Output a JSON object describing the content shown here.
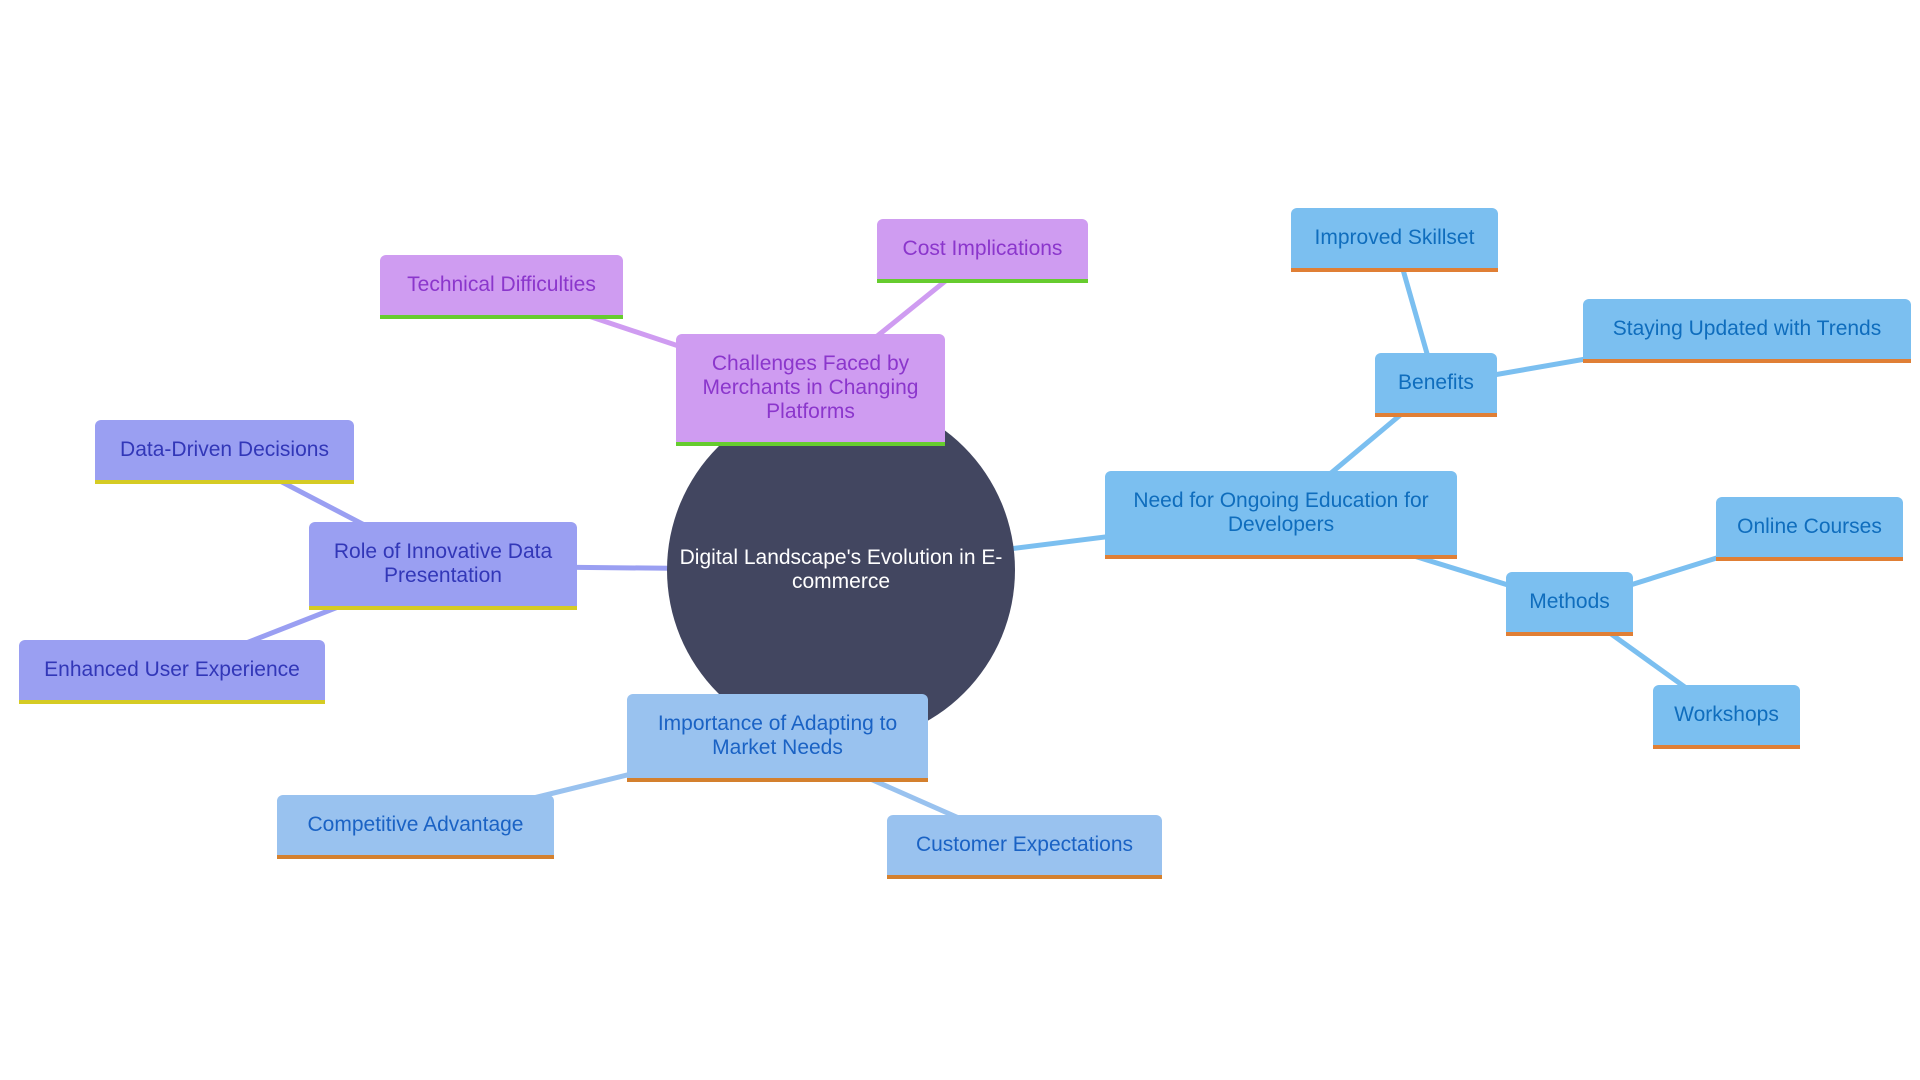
{
  "diagram": {
    "type": "mindmap",
    "root": {
      "id": "root",
      "label": "Digital Landscape's Evolution in E-commerce",
      "color": "#424660"
    },
    "branches": [
      {
        "id": "challenges",
        "label": "Challenges Faced by Merchants in Changing Platforms",
        "theme": "purple",
        "fill": "#cf9cf1",
        "text_color": "#8b36cc",
        "underline": "#66cc2e",
        "edge_color": "#cf9cf1",
        "children": [
          {
            "id": "tech",
            "label": "Technical Difficulties"
          },
          {
            "id": "cost",
            "label": "Cost Implications"
          }
        ]
      },
      {
        "id": "education",
        "label": "Need for Ongoing Education for Developers",
        "theme": "blue",
        "fill": "#7bbff0",
        "text_color": "#0f6dbd",
        "underline": "#e07f35",
        "edge_color": "#7bbff0",
        "children": [
          {
            "id": "benefits",
            "label": "Benefits",
            "children": [
              {
                "id": "skillset",
                "label": "Improved Skillset"
              },
              {
                "id": "trends",
                "label": "Staying Updated with Trends"
              }
            ]
          },
          {
            "id": "methods",
            "label": "Methods",
            "children": [
              {
                "id": "courses",
                "label": "Online Courses"
              },
              {
                "id": "workshops",
                "label": "Workshops"
              }
            ]
          }
        ]
      },
      {
        "id": "role",
        "label": "Role of Innovative Data Presentation",
        "theme": "indigo",
        "fill": "#9a9ff2",
        "text_color": "#3237b8",
        "underline": "#d5cb24",
        "edge_color": "#9a9ff2",
        "children": [
          {
            "id": "datadriven",
            "label": "Data-Driven Decisions"
          },
          {
            "id": "ux",
            "label": "Enhanced User Experience"
          }
        ]
      },
      {
        "id": "importance",
        "label": "Importance of Adapting to Market Needs",
        "theme": "lblue",
        "fill": "#99c2ef",
        "text_color": "#1a62c4",
        "underline": "#d4802e",
        "edge_color": "#99c2ef",
        "children": [
          {
            "id": "competitive",
            "label": "Competitive Advantage"
          },
          {
            "id": "customer",
            "label": "Customer Expectations"
          }
        ]
      }
    ],
    "edges": [
      {
        "from": "root",
        "to": "challenges",
        "color": "#cf9cf1"
      },
      {
        "from": "challenges",
        "to": "tech",
        "color": "#cf9cf1"
      },
      {
        "from": "challenges",
        "to": "cost",
        "color": "#cf9cf1"
      },
      {
        "from": "root",
        "to": "education",
        "color": "#7bbff0"
      },
      {
        "from": "education",
        "to": "benefits",
        "color": "#7bbff0"
      },
      {
        "from": "benefits",
        "to": "skillset",
        "color": "#7bbff0"
      },
      {
        "from": "benefits",
        "to": "trends",
        "color": "#7bbff0"
      },
      {
        "from": "education",
        "to": "methods",
        "color": "#7bbff0"
      },
      {
        "from": "methods",
        "to": "courses",
        "color": "#7bbff0"
      },
      {
        "from": "methods",
        "to": "workshops",
        "color": "#7bbff0"
      },
      {
        "from": "root",
        "to": "role",
        "color": "#9a9ff2"
      },
      {
        "from": "role",
        "to": "datadriven",
        "color": "#9a9ff2"
      },
      {
        "from": "role",
        "to": "ux",
        "color": "#9a9ff2"
      },
      {
        "from": "root",
        "to": "importance",
        "color": "#99c2ef"
      },
      {
        "from": "importance",
        "to": "competitive",
        "color": "#99c2ef"
      },
      {
        "from": "importance",
        "to": "customer",
        "color": "#99c2ef"
      }
    ]
  }
}
